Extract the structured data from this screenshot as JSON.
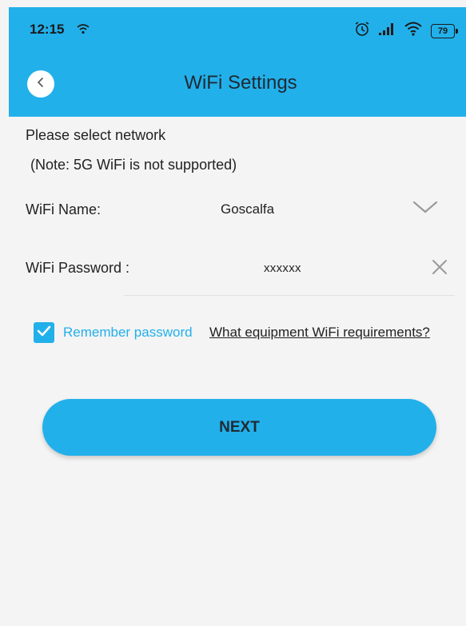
{
  "status_bar": {
    "time": "12:15",
    "battery": "79",
    "left_icon": "wifi-small-icon",
    "right_icons": [
      "alarm-icon",
      "signal-icon",
      "wifi-icon",
      "battery-icon"
    ]
  },
  "header": {
    "title": "WiFi Settings",
    "back_icon": "chevron-left-icon",
    "color": "#22b0ea"
  },
  "form": {
    "select_label": "Please select network",
    "note": "(Note: 5G WiFi is not supported)",
    "wifi_name_label": "WiFi Name:",
    "wifi_name_value": "Goscalfa",
    "wifi_password_label": "WiFi Password :",
    "wifi_password_value": "xxxxxx",
    "remember_label": "Remember password",
    "remember_checked": true,
    "requirements_link": "What equipment WiFi requirements?"
  },
  "actions": {
    "next_label": "NEXT"
  }
}
